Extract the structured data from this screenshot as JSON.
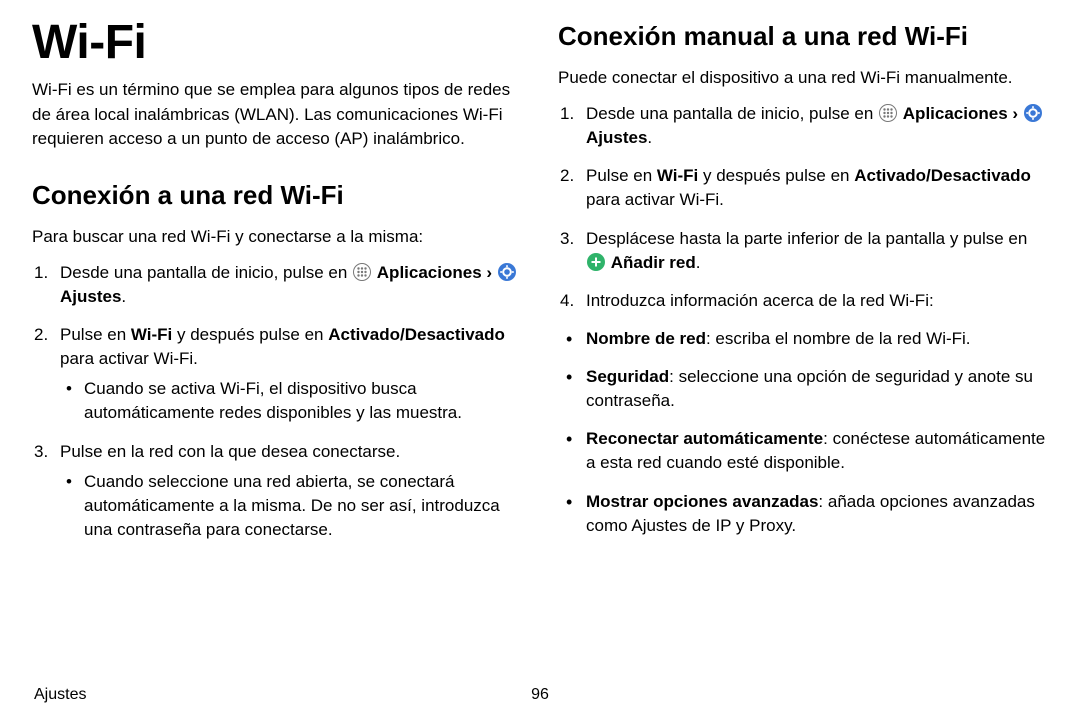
{
  "title": "Wi-Fi",
  "intro": "Wi-Fi es un término que se emplea para algunos tipos de redes de área local inalámbricas (WLAN). Las comunicaciones Wi-Fi requieren acceso a un punto de acceso (AP) inalámbrico.",
  "section1": {
    "heading": "Conexión a una red Wi-Fi",
    "lead": "Para buscar una red Wi-Fi y conectarse a la misma:",
    "step1_pre": "Desde una pantalla de inicio, pulse en ",
    "apps_label": "Aplicaciones",
    "sep": " › ",
    "settings_label": "Ajustes",
    "step1_post": ".",
    "step2_a": "Pulse en ",
    "step2_wifi": "Wi-Fi",
    "step2_b": " y después pulse en ",
    "step2_toggle": "Activado/Desactivado",
    "step2_c": " para activar Wi-Fi.",
    "step2_sub": "Cuando se activa Wi-Fi, el dispositivo busca automáticamente redes disponibles y las muestra.",
    "step3": "Pulse en la red con la que desea conectarse.",
    "step3_sub": "Cuando seleccione una red abierta, se conectará automáticamente a la misma. De no ser así, introduzca una contraseña para conectarse."
  },
  "section2": {
    "heading": "Conexión manual a una red Wi-Fi",
    "lead": "Puede conectar el dispositivo a una red Wi-Fi manualmente.",
    "step1_pre": "Desde una pantalla de inicio, pulse en ",
    "apps_label": "Aplicaciones",
    "sep": " › ",
    "settings_label": "Ajustes",
    "step1_post": ".",
    "step2_a": "Pulse en ",
    "step2_wifi": "Wi-Fi",
    "step2_b": " y después pulse en ",
    "step2_toggle": "Activado/Desactivado",
    "step2_c": " para activar Wi-Fi.",
    "step3_a": "Desplácese hasta la parte inferior de la pantalla y pulse en ",
    "step3_add": "Añadir red",
    "step3_b": ".",
    "step4": "Introduzca información acerca de la red Wi-Fi:",
    "b1_t": "Nombre de red",
    "b1_r": ": escriba el nombre de la red Wi-Fi.",
    "b2_t": "Seguridad",
    "b2_r": ": seleccione una opción de seguridad y anote su contraseña.",
    "b3_t": "Reconectar automáticamente",
    "b3_r": ": conéctese automáticamente a esta red cuando esté disponible.",
    "b4_t": "Mostrar opciones avanzadas",
    "b4_r": ": añada opciones avanzadas como Ajustes de IP y Proxy."
  },
  "footer": {
    "section": "Ajustes",
    "page": "96"
  }
}
